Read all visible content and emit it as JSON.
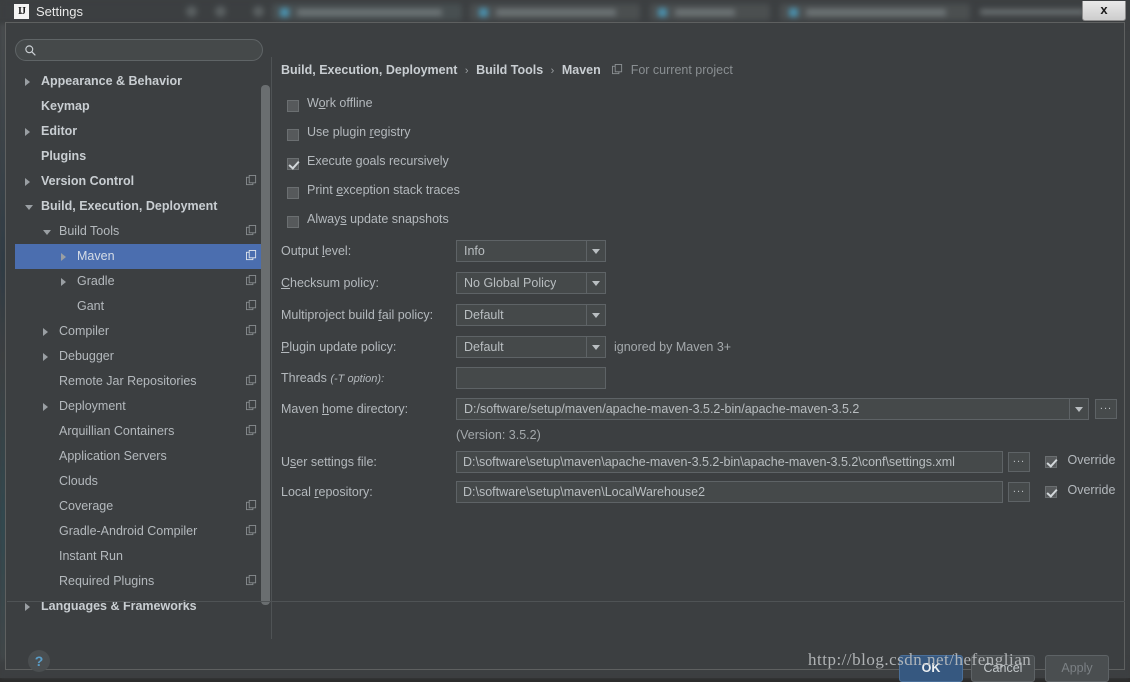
{
  "window": {
    "title": "Settings",
    "app_icon": "IJ",
    "close_label": "x"
  },
  "search": {
    "placeholder": "",
    "value": "",
    "icon": "search-icon"
  },
  "sidebar": {
    "items": [
      {
        "label": "Appearance & Behavior",
        "indent": 0,
        "arrow": "right",
        "bold": true,
        "module_icon": false,
        "selected": false
      },
      {
        "label": "Keymap",
        "indent": 0,
        "arrow": "none",
        "bold": true,
        "module_icon": false,
        "selected": false
      },
      {
        "label": "Editor",
        "indent": 0,
        "arrow": "right",
        "bold": true,
        "module_icon": false,
        "selected": false
      },
      {
        "label": "Plugins",
        "indent": 0,
        "arrow": "none",
        "bold": true,
        "module_icon": false,
        "selected": false
      },
      {
        "label": "Version Control",
        "indent": 0,
        "arrow": "right",
        "bold": true,
        "module_icon": true,
        "selected": false
      },
      {
        "label": "Build, Execution, Deployment",
        "indent": 0,
        "arrow": "down",
        "bold": true,
        "module_icon": false,
        "selected": false
      },
      {
        "label": "Build Tools",
        "indent": 1,
        "arrow": "down",
        "bold": false,
        "module_icon": true,
        "selected": false
      },
      {
        "label": "Maven",
        "indent": 2,
        "arrow": "right",
        "bold": false,
        "module_icon": true,
        "selected": true
      },
      {
        "label": "Gradle",
        "indent": 2,
        "arrow": "right",
        "bold": false,
        "module_icon": true,
        "selected": false
      },
      {
        "label": "Gant",
        "indent": 2,
        "arrow": "none",
        "bold": false,
        "module_icon": true,
        "selected": false
      },
      {
        "label": "Compiler",
        "indent": 1,
        "arrow": "right",
        "bold": false,
        "module_icon": true,
        "selected": false
      },
      {
        "label": "Debugger",
        "indent": 1,
        "arrow": "right",
        "bold": false,
        "module_icon": false,
        "selected": false
      },
      {
        "label": "Remote Jar Repositories",
        "indent": 1,
        "arrow": "none",
        "bold": false,
        "module_icon": true,
        "selected": false
      },
      {
        "label": "Deployment",
        "indent": 1,
        "arrow": "right",
        "bold": false,
        "module_icon": true,
        "selected": false
      },
      {
        "label": "Arquillian Containers",
        "indent": 1,
        "arrow": "none",
        "bold": false,
        "module_icon": true,
        "selected": false
      },
      {
        "label": "Application Servers",
        "indent": 1,
        "arrow": "none",
        "bold": false,
        "module_icon": false,
        "selected": false
      },
      {
        "label": "Clouds",
        "indent": 1,
        "arrow": "none",
        "bold": false,
        "module_icon": false,
        "selected": false
      },
      {
        "label": "Coverage",
        "indent": 1,
        "arrow": "none",
        "bold": false,
        "module_icon": true,
        "selected": false
      },
      {
        "label": "Gradle-Android Compiler",
        "indent": 1,
        "arrow": "none",
        "bold": false,
        "module_icon": true,
        "selected": false
      },
      {
        "label": "Instant Run",
        "indent": 1,
        "arrow": "none",
        "bold": false,
        "module_icon": false,
        "selected": false
      },
      {
        "label": "Required Plugins",
        "indent": 1,
        "arrow": "none",
        "bold": false,
        "module_icon": true,
        "selected": false
      },
      {
        "label": "Languages & Frameworks",
        "indent": 0,
        "arrow": "right",
        "bold": true,
        "module_icon": false,
        "selected": false
      }
    ]
  },
  "breadcrumb": {
    "part1": "Build, Execution, Deployment",
    "sep": "›",
    "part2": "Build Tools",
    "part3": "Maven",
    "scope_note": "For current project",
    "scope_icon": "module-icon"
  },
  "checkboxes": [
    {
      "label": "Work offline",
      "mnemonic": "o",
      "checked": false
    },
    {
      "label": "Use plugin registry",
      "mnemonic": "r",
      "checked": false
    },
    {
      "label": "Execute goals recursively",
      "mnemonic": "g",
      "checked": true
    },
    {
      "label": "Print exception stack traces",
      "mnemonic": "e",
      "checked": false
    },
    {
      "label": "Always update snapshots",
      "mnemonic": "s",
      "checked": false
    }
  ],
  "fields": {
    "output_level": {
      "label": "Output level:",
      "value": "Info"
    },
    "checksum_policy": {
      "label": "Checksum policy:",
      "value": "No Global Policy"
    },
    "multiproject_fail_policy": {
      "label": "Multiproject build fail policy:",
      "value": "Default"
    },
    "plugin_update_policy": {
      "label": "Plugin update policy:",
      "value": "Default",
      "hint": "ignored by Maven 3+"
    },
    "threads": {
      "label": "Threads",
      "label_italic": "(-T option):",
      "value": ""
    },
    "maven_home": {
      "label": "Maven home directory:",
      "value": "D:/software/setup/maven/apache-maven-3.5.2-bin/apache-maven-3.5.2",
      "version_note": "(Version: 3.5.2)",
      "browse": "..."
    },
    "user_settings": {
      "label": "User settings file:",
      "value": "D:\\software\\setup\\maven\\apache-maven-3.5.2-bin\\apache-maven-3.5.2\\conf\\settings.xml",
      "browse": "...",
      "override_label": "Override",
      "override_checked": true
    },
    "local_repository": {
      "label": "Local repository:",
      "value": "D:\\software\\setup\\maven\\LocalWarehouse2",
      "browse": "...",
      "override_label": "Override",
      "override_checked": true
    }
  },
  "footer": {
    "help_label": "?",
    "ok_label": "OK",
    "cancel_label": "Cancel",
    "apply_label": "Apply",
    "apply_disabled": true
  },
  "watermark": "http://blog.csdn.net/hefenglian",
  "colors": {
    "dialog_bg": "#3c3f41",
    "selection_blue": "#4b6eaf",
    "primary_button": "#365880",
    "text": "#b4b9bd",
    "field_bg": "#45494a"
  }
}
